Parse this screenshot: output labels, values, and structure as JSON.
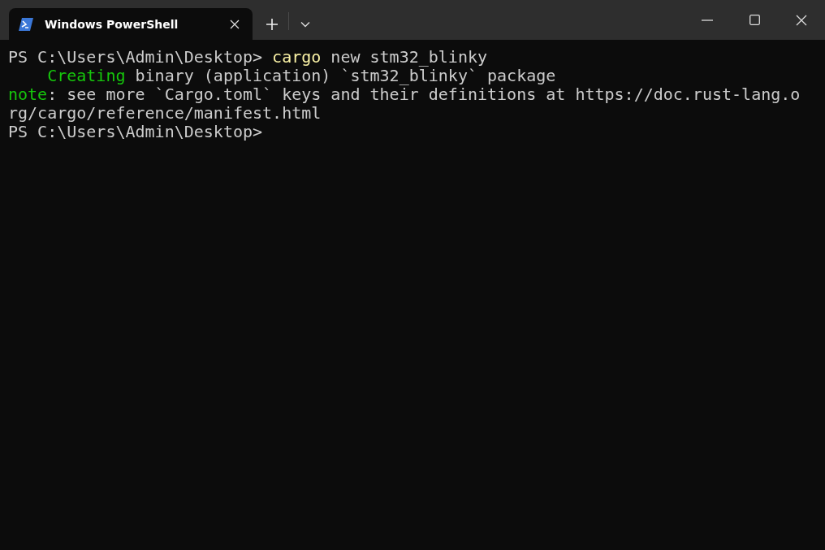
{
  "tab": {
    "title": "Windows PowerShell",
    "selected": true
  },
  "terminal": {
    "lines": [
      {
        "segments": [
          {
            "kind": "plain",
            "text": "PS C:\\Users\\Admin\\Desktop> "
          },
          {
            "kind": "command",
            "text": "cargo"
          },
          {
            "kind": "plain",
            "text": " new stm32_blinky"
          }
        ]
      },
      {
        "indented": true,
        "segments": [
          {
            "kind": "success",
            "text": "Creating"
          },
          {
            "kind": "plain",
            "text": " binary (application) `stm32_blinky` package"
          }
        ]
      },
      {
        "segments": [
          {
            "kind": "success",
            "text": "note"
          },
          {
            "kind": "plain",
            "text": ": see more `Cargo.toml` keys and their definitions at https://doc.rust-lang.o"
          }
        ]
      },
      {
        "segments": [
          {
            "kind": "plain",
            "text": "rg/cargo/reference/manifest.html"
          }
        ]
      },
      {
        "segments": [
          {
            "kind": "plain",
            "text": "PS C:\\Users\\Admin\\Desktop>"
          }
        ]
      }
    ]
  }
}
